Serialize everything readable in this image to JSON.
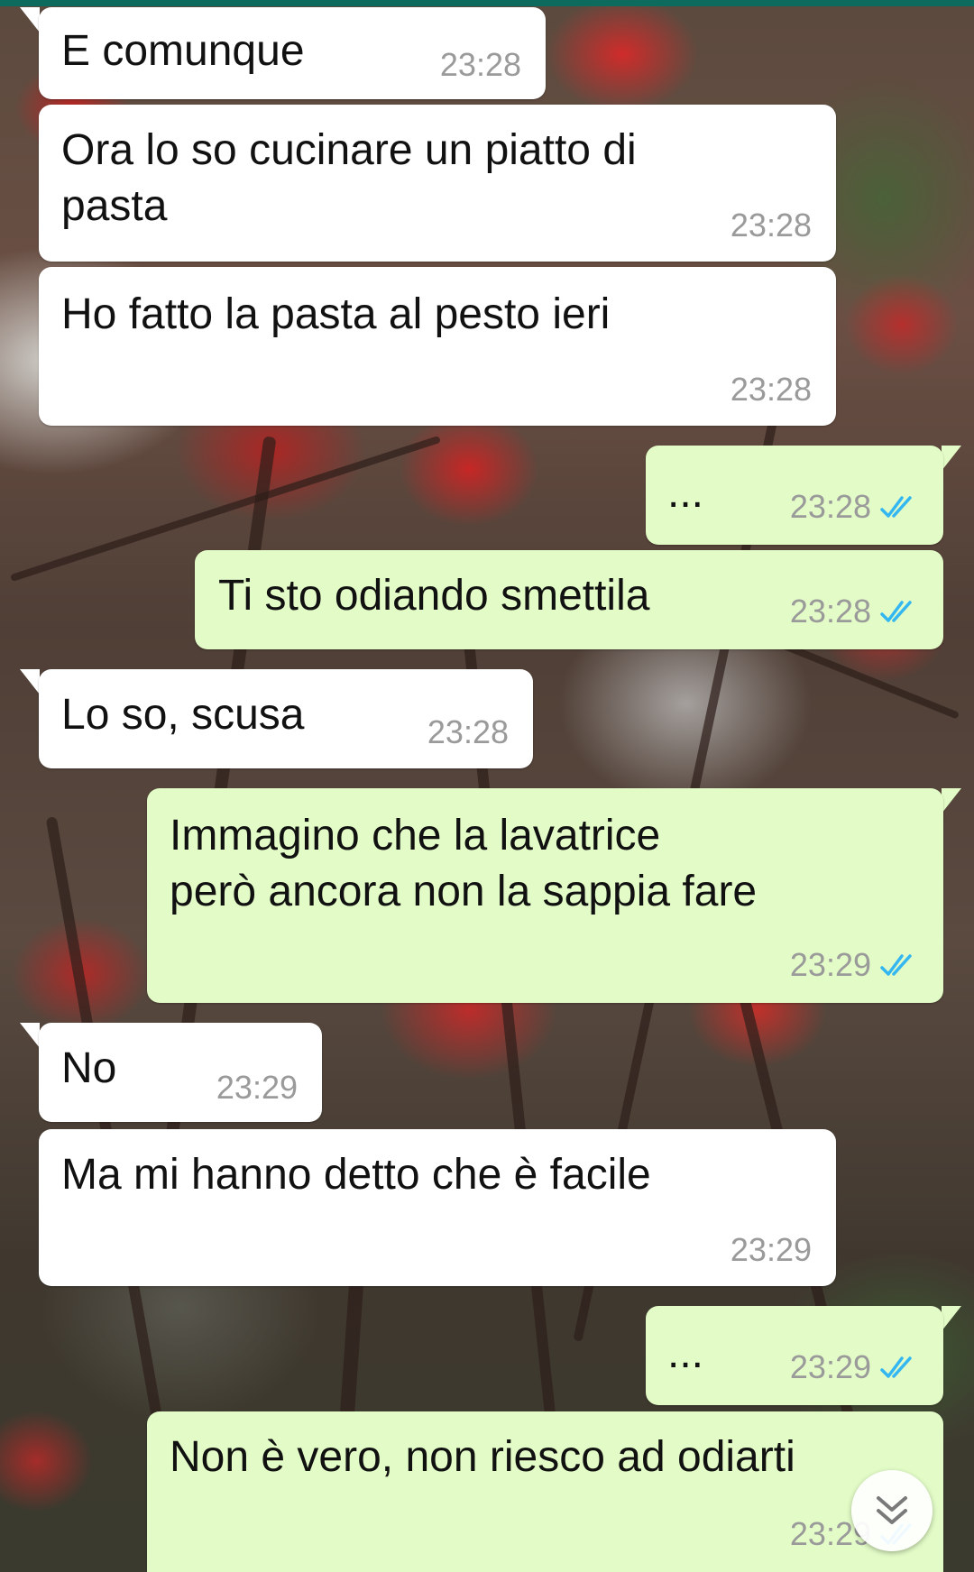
{
  "theme": {
    "incoming_bg": "#ffffff",
    "outgoing_bg": "#e3fcc7",
    "header_color": "#0c6b5c",
    "read_tick_color": "#34b7f1"
  },
  "messages": [
    {
      "direction": "in",
      "text": "E comunque",
      "time": "23:28"
    },
    {
      "direction": "in",
      "text": "Ora lo so cucinare un piatto di\npasta",
      "time": "23:28"
    },
    {
      "direction": "in",
      "text": "Ho fatto la pasta al pesto ieri",
      "time": "23:28"
    },
    {
      "direction": "out",
      "text": "...",
      "time": "23:28",
      "status": "read"
    },
    {
      "direction": "out",
      "text": "Ti sto odiando smettila",
      "time": "23:28",
      "status": "read"
    },
    {
      "direction": "in",
      "text": "Lo so, scusa",
      "time": "23:28"
    },
    {
      "direction": "out",
      "text": "Immagino che la lavatrice\nperò ancora non la sappia fare",
      "time": "23:29",
      "status": "read"
    },
    {
      "direction": "in",
      "text": "No",
      "time": "23:29"
    },
    {
      "direction": "in",
      "text": "Ma mi hanno detto che è facile",
      "time": "23:29"
    },
    {
      "direction": "out",
      "text": "...",
      "time": "23:29",
      "status": "read"
    },
    {
      "direction": "out",
      "text": "Non è vero, non riesco ad odiarti",
      "time": "23:29",
      "status": "read"
    }
  ],
  "scroll_button": {
    "icon": "double-chevron-down-icon"
  }
}
